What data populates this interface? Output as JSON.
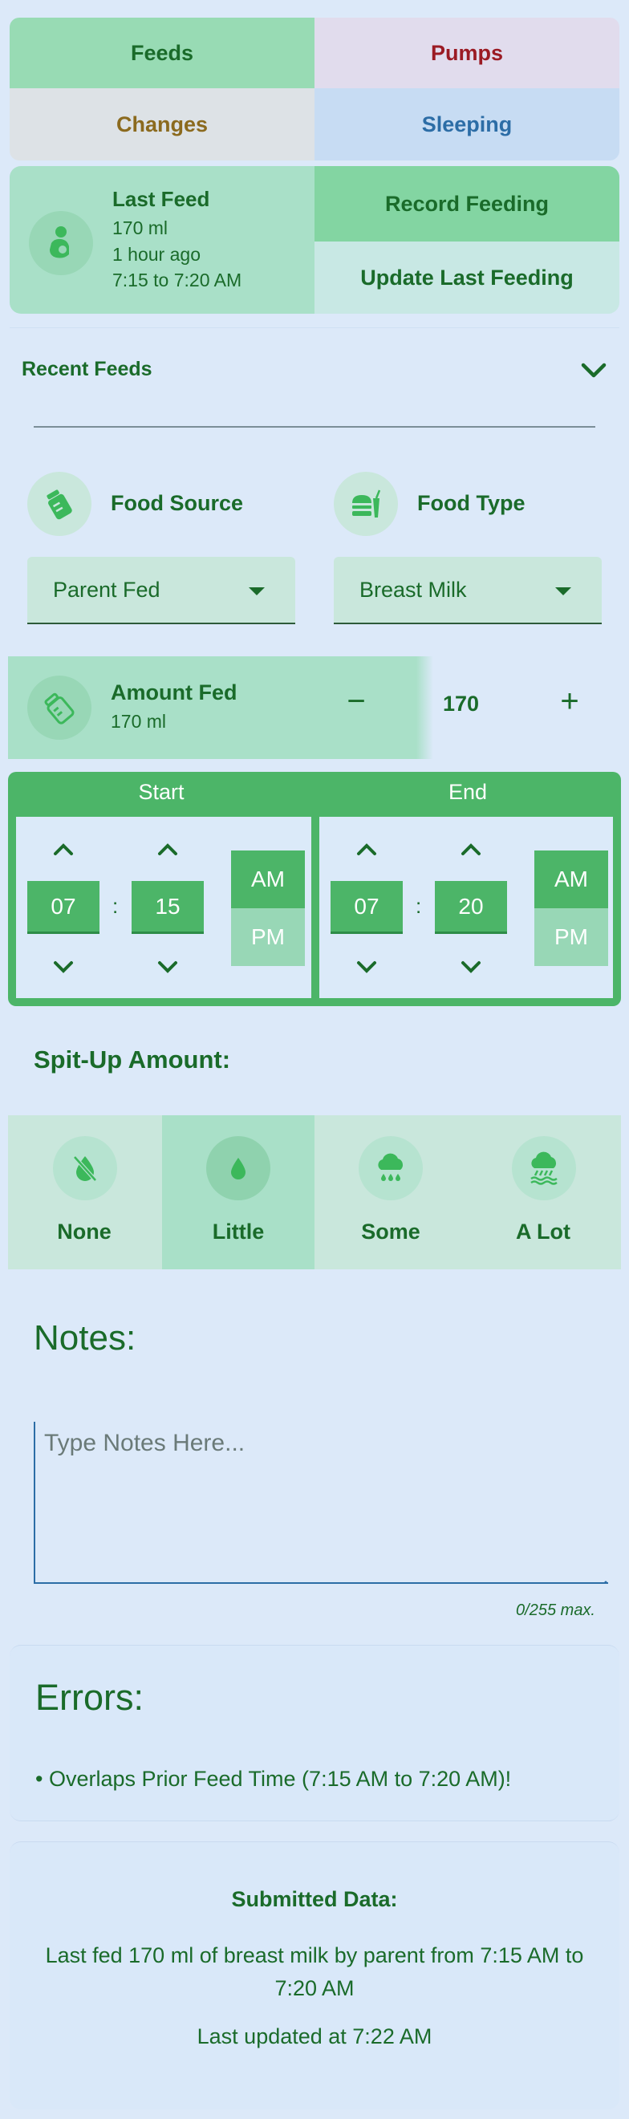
{
  "categories": {
    "feeds": "Feeds",
    "pumps": "Pumps",
    "changes": "Changes",
    "sleeping": "Sleeping"
  },
  "last_feed": {
    "title": "Last Feed",
    "amount": "170 ml",
    "ago": "1 hour ago",
    "range": "7:15 to 7:20 AM",
    "icon": "feeding-baby-icon"
  },
  "actions": {
    "record": "Record Feeding",
    "update": "Update Last Feeding"
  },
  "recent_feeds": {
    "title": "Recent Feeds",
    "icon": "chevron-down-icon"
  },
  "food_source": {
    "label": "Food Source",
    "value": "Parent Fed",
    "icon": "bottle-icon"
  },
  "food_type": {
    "label": "Food Type",
    "value": "Breast Milk",
    "icon": "food-icon"
  },
  "amount": {
    "label": "Amount Fed",
    "sub": "170 ml",
    "value": "170",
    "minus": "−",
    "plus": "+"
  },
  "time": {
    "start": {
      "header": "Start",
      "hour": "07",
      "minute": "15",
      "am": "AM",
      "pm": "PM",
      "selected": "AM"
    },
    "end": {
      "header": "End",
      "hour": "07",
      "minute": "20",
      "am": "AM",
      "pm": "PM",
      "selected": "AM"
    },
    "separator": ":"
  },
  "spit_up": {
    "title": "Spit-Up Amount:",
    "options": [
      {
        "label": "None",
        "icon": "no-drop-icon"
      },
      {
        "label": "Little",
        "icon": "drop-icon"
      },
      {
        "label": "Some",
        "icon": "cloud-drops-icon"
      },
      {
        "label": "A Lot",
        "icon": "cloud-rain-icon"
      }
    ],
    "selected": "Little"
  },
  "notes": {
    "title": "Notes:",
    "placeholder": "Type Notes Here...",
    "count": "0/255 max."
  },
  "errors": {
    "title": "Errors:",
    "items": [
      "• Overlaps Prior Feed Time (7:15 AM to 7:20 AM)!"
    ]
  },
  "submitted": {
    "title": "Submitted Data:",
    "text": "Last fed 170 ml of breast milk by parent from 7:15 AM to 7:20 AM",
    "updated": "Last updated at 7:22 AM"
  },
  "colors": {
    "background": "#dce9f9",
    "green_dark": "#1a6b2a",
    "green_accent": "#4cb568",
    "pumps": "#9b1b24",
    "changes": "#8b6a1e",
    "sleeping": "#2c6da6"
  }
}
